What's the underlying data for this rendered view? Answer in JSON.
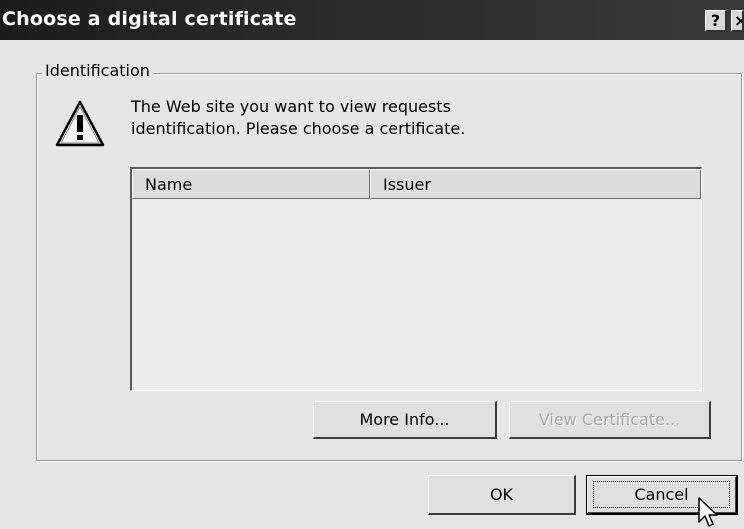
{
  "window": {
    "title": "Choose a digital certificate",
    "help_label": "?",
    "close_label": "×"
  },
  "group": {
    "label": "Identification"
  },
  "message": {
    "line1": "The Web site you want to view requests",
    "line2": "identification. Please choose a certificate."
  },
  "list": {
    "columns": [
      "Name",
      "Issuer"
    ],
    "rows": []
  },
  "buttons": {
    "more_info": "More Info...",
    "view_certificate": "View Certificate...",
    "ok": "OK",
    "cancel": "Cancel"
  },
  "icons": {
    "warning": "warning-icon",
    "cursor": "mouse-pointer-icon"
  },
  "state": {
    "view_certificate_enabled": false,
    "default_button": "cancel"
  }
}
